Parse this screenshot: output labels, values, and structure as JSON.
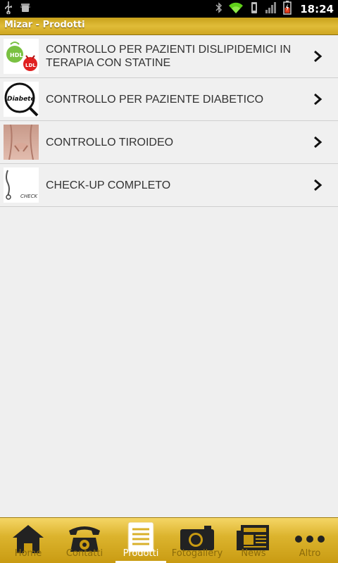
{
  "status_bar": {
    "time": "18:24",
    "icons_left": [
      "usb-icon",
      "android-debug-icon"
    ],
    "icons_right": [
      "bluetooth-icon",
      "wifi-icon",
      "vibrate-icon",
      "signal-icon",
      "battery-icon"
    ]
  },
  "title_bar": {
    "title": "Mizar - Prodotti"
  },
  "products": [
    {
      "label": "CONTROLLO PER PAZIENTI DISLIPIDEMICI IN TERAPIA CON STATINE",
      "thumb": "hdl-ldl",
      "thumb_text_1": "HDL",
      "thumb_text_2": "LDL"
    },
    {
      "label": "CONTROLLO PER PAZIENTE DIABETICO",
      "thumb": "diabete",
      "thumb_text_1": "Diabete"
    },
    {
      "label": "CONTROLLO TIROIDEO",
      "thumb": "thyroid"
    },
    {
      "label": "CHECK-UP COMPLETO",
      "thumb": "checkup",
      "thumb_text_1": "CHECK"
    }
  ],
  "tabs": [
    {
      "label": "Home",
      "icon": "home-icon",
      "active": false
    },
    {
      "label": "Contatti",
      "icon": "phone-icon",
      "active": false
    },
    {
      "label": "Prodotti",
      "icon": "list-icon",
      "active": true
    },
    {
      "label": "Fotogallery",
      "icon": "camera-icon",
      "active": false
    },
    {
      "label": "News",
      "icon": "newspaper-icon",
      "active": false
    },
    {
      "label": "Altro",
      "icon": "more-icon",
      "active": false
    }
  ],
  "colors": {
    "accent": "#d9b02a",
    "tab_label": "#8a6a0a",
    "text": "#333333"
  }
}
